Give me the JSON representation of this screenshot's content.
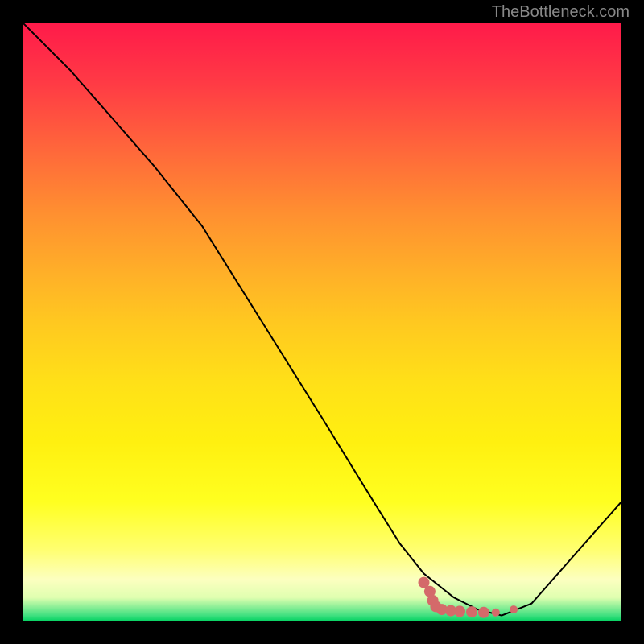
{
  "watermark": "TheBottleneck.com",
  "chart_data": {
    "type": "line",
    "title": "",
    "xlabel": "",
    "ylabel": "",
    "xlim": [
      0,
      100
    ],
    "ylim": [
      0,
      100
    ],
    "grid": false,
    "series": [
      {
        "name": "curve",
        "color": "#000000",
        "x": [
          0,
          8,
          15,
          22,
          26,
          30,
          40,
          50,
          58,
          63,
          67,
          72,
          76,
          80,
          85,
          100
        ],
        "values": [
          100,
          92,
          84,
          76,
          71,
          66,
          50,
          34,
          21,
          13,
          8,
          4,
          2,
          1,
          3,
          20
        ]
      }
    ],
    "scatter_points": {
      "name": "points",
      "color": "#d46a6a",
      "points": [
        {
          "x": 67,
          "y": 6.5
        },
        {
          "x": 68,
          "y": 5.0
        },
        {
          "x": 68.5,
          "y": 3.5
        },
        {
          "x": 69,
          "y": 2.5
        },
        {
          "x": 70,
          "y": 2.0
        },
        {
          "x": 71.5,
          "y": 1.8
        },
        {
          "x": 73,
          "y": 1.7
        },
        {
          "x": 75,
          "y": 1.6
        },
        {
          "x": 77,
          "y": 1.5
        },
        {
          "x": 79,
          "y": 1.5
        },
        {
          "x": 82,
          "y": 2.0
        }
      ]
    },
    "gradient_stops": [
      {
        "pos": 0,
        "color": "#ff1a4a"
      },
      {
        "pos": 50,
        "color": "#ffc820"
      },
      {
        "pos": 80,
        "color": "#ffff20"
      },
      {
        "pos": 100,
        "color": "#00d060"
      }
    ]
  }
}
